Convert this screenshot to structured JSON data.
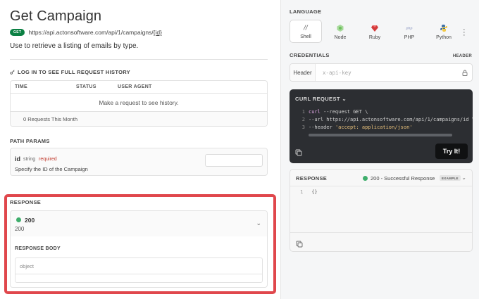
{
  "page": {
    "title": "Get Campaign",
    "method": "GET",
    "url_prefix": "https://api.actonsoftware.com/api/1/campaigns/",
    "url_param": "{id}",
    "description": "Use to retrieve a listing of emails by type."
  },
  "history": {
    "login_label": "LOG IN TO SEE FULL REQUEST HISTORY",
    "columns": [
      "TIME",
      "STATUS",
      "USER AGENT"
    ],
    "empty_message": "Make a request to see history.",
    "count_label": "0 Requests This Month"
  },
  "path_params": {
    "label": "PATH PARAMS",
    "name": "id",
    "type": "string",
    "required": "required",
    "description": "Specify the ID of the Campaign"
  },
  "response": {
    "label": "RESPONSE",
    "code": "200",
    "code_desc": "200",
    "body_label": "RESPONSE BODY",
    "body_type": "object"
  },
  "language": {
    "label": "LANGUAGE",
    "items": [
      {
        "name": "Shell",
        "icon": "shell-icon",
        "active": true
      },
      {
        "name": "Node",
        "icon": "node-icon",
        "active": false
      },
      {
        "name": "Ruby",
        "icon": "ruby-icon",
        "active": false
      },
      {
        "name": "PHP",
        "icon": "php-icon",
        "active": false
      },
      {
        "name": "Python",
        "icon": "python-icon",
        "active": false
      }
    ]
  },
  "credentials": {
    "label": "CREDENTIALS",
    "header_label": "HEADER",
    "key": "Header",
    "placeholder": "x-api-key"
  },
  "curl": {
    "label": "CURL REQUEST",
    "lines": [
      {
        "n": "1",
        "cmd": "curl",
        "rest": " --request GET \\"
      },
      {
        "n": "2",
        "rest": "     --url https://api.actonsoftware.com/api/1/campaigns/id \\"
      },
      {
        "n": "3",
        "flag": "     --header ",
        "str": "'accept: application/json'"
      }
    ],
    "try_label": "Try It!"
  },
  "response_panel": {
    "label": "RESPONSE",
    "status": "200 - Successful Response",
    "badge": "EXAMPLE",
    "line_no": "1",
    "code": "{}"
  },
  "colors": {
    "get_badge": "#0b8043",
    "success_dot": "#3fae6c",
    "highlight": "#e0474c",
    "required": "#c0392b",
    "code_bg": "#2c2e32"
  }
}
